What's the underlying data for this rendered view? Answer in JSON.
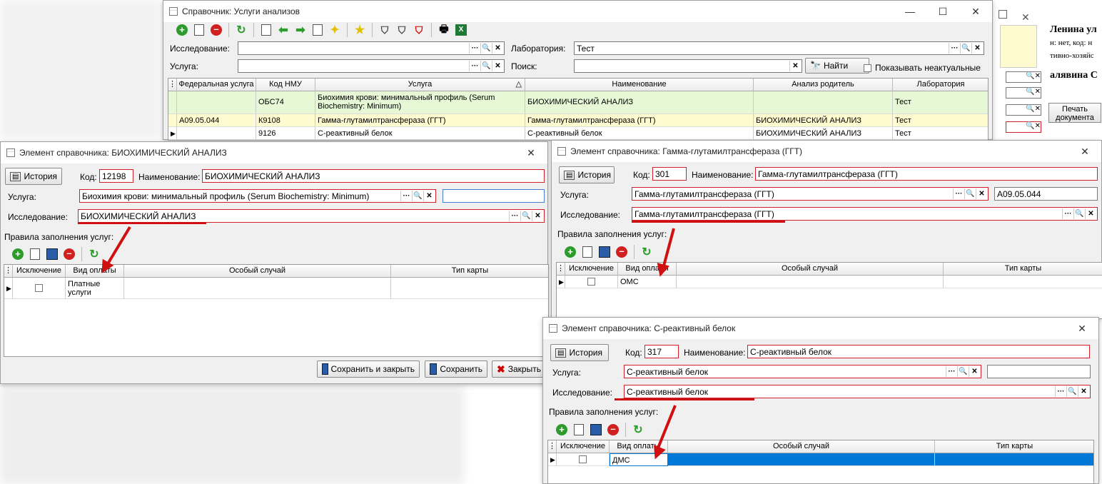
{
  "main_window": {
    "title": "Справочник: Услуги анализов",
    "research_label": "Исследование:",
    "research_value": "",
    "lab_label": "Лаборатория:",
    "lab_value": "Тест",
    "service_label": "Услуга:",
    "service_value": "",
    "search_label": "Поиск:",
    "search_value": "",
    "find_button": "Найти",
    "show_inactive_label": "Показывать неактуальные",
    "columns": [
      "Федеральная услуга",
      "Код НМУ",
      "Услуга",
      "Наименование",
      "Анализ родитель",
      "Лаборатория"
    ],
    "rows": [
      {
        "fed": "",
        "code": "ОБС74",
        "service": "Биохимия крови: минимальный профиль (Serum Biochemistry: Minimum)",
        "name": "БИОХИМИЧЕСКИЙ АНАЛИЗ",
        "parent": "",
        "lab": "Тест"
      },
      {
        "fed": "A09.05.044",
        "code": "К9108",
        "service": "Гамма-глутамилтрансфераза (ГГТ)",
        "name": "Гамма-глутамилтрансфераза (ГГТ)",
        "parent": "БИОХИМИЧЕСКИЙ АНАЛИЗ",
        "lab": "Тест"
      },
      {
        "fed": "",
        "code": "9126",
        "service": "С-реактивный белок",
        "name": "С-реактивный белок",
        "parent": "БИОХИМИЧЕСКИЙ АНАЛИЗ",
        "lab": "Тест"
      }
    ]
  },
  "background_right": {
    "text1": "Ленина ул",
    "text2": "н: нет, код: н",
    "text3": "тивно-хозяйс",
    "text4": "алявина С",
    "print_button": "Печать документа"
  },
  "dialog1": {
    "title": "Элемент справочника: БИОХИМИЧЕСКИЙ АНАЛИЗ",
    "history_button": "История",
    "code_label": "Код:",
    "code_value": "12198",
    "name_label": "Наименование:",
    "name_value": "БИОХИМИЧЕСКИЙ АНАЛИЗ",
    "service_label": "Услуга:",
    "service_value": "Биохимия крови: минимальный профиль (Serum Biochemistry: Minimum)",
    "research_label": "Исследование:",
    "research_value": "БИОХИМИЧЕСКИЙ АНАЛИЗ",
    "rules_label": "Правила заполнения услуг:",
    "columns": [
      "Исключение",
      "Вид оплаты",
      "Особый случай",
      "Тип карты"
    ],
    "row_payment": "Платные услуги",
    "save_close_button": "Сохранить и закрыть",
    "save_button": "Сохранить",
    "close_button": "Закрыть"
  },
  "dialog2": {
    "title": "Элемент справочника: Гамма-глутамилтрансфераза (ГГТ)",
    "history_button": "История",
    "code_label": "Код:",
    "code_value": "301",
    "name_label": "Наименование:",
    "name_value": "Гамма-глутамилтрансфераза (ГГТ)",
    "service_label": "Услуга:",
    "service_value": "Гамма-глутамилтрансфераза (ГГТ)",
    "fed_code": "A09.05.044",
    "research_label": "Исследование:",
    "research_value": "Гамма-глутамилтрансфераза (ГГТ)",
    "rules_label": "Правила заполнения услуг:",
    "columns": [
      "Исключение",
      "Вид оплаты",
      "Особый случай",
      "Тип карты"
    ],
    "row_payment": "ОМС"
  },
  "dialog3": {
    "title": "Элемент справочника: С-реактивный белок",
    "history_button": "История",
    "code_label": "Код:",
    "code_value": "317",
    "name_label": "Наименование:",
    "name_value": "С-реактивный белок",
    "service_label": "Услуга:",
    "service_value": "С-реактивный белок",
    "research_label": "Исследование:",
    "research_value": "С-реактивный белок",
    "rules_label": "Правила заполнения услуг:",
    "columns": [
      "Исключение",
      "Вид оплаты",
      "Особый случай",
      "Тип карты"
    ],
    "row_payment": "ДМС"
  },
  "icons": {
    "window": "table-icon",
    "history": "history-icon",
    "add": "plus-icon",
    "remove": "minus-icon",
    "refresh": "refresh-icon"
  },
  "colors": {
    "highlight_red": "#d01010",
    "row_green": "#e6f8d6",
    "row_yellow": "#fffbd0",
    "selected_blue": "#0078d7"
  }
}
